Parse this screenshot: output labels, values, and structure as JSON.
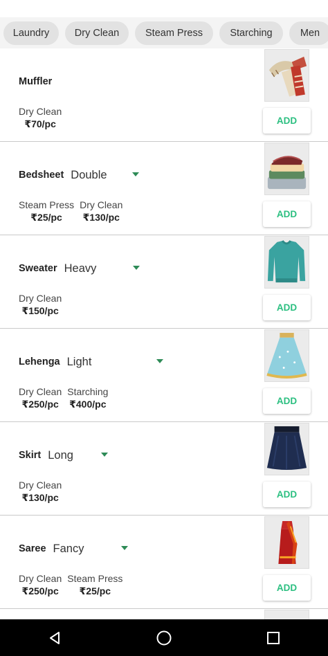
{
  "tabs": [
    "Laundry",
    "Dry Clean",
    "Steam Press",
    "Starching",
    "Men"
  ],
  "accent_color": "#2bbf80",
  "items": [
    {
      "name": "Muffler",
      "variant": "",
      "icon": "muffler-icon",
      "services": [
        {
          "name": "Dry Clean",
          "price": "₹70/pc"
        }
      ],
      "add_label": "ADD"
    },
    {
      "name": "Bedsheet",
      "variant": "Double",
      "icon": "bedsheet-icon",
      "services": [
        {
          "name": "Steam Press",
          "price": "₹25/pc"
        },
        {
          "name": "Dry Clean",
          "price": "₹130/pc"
        }
      ],
      "add_label": "ADD"
    },
    {
      "name": "Sweater",
      "variant": "Heavy",
      "icon": "sweater-icon",
      "services": [
        {
          "name": "Dry Clean",
          "price": "₹150/pc"
        }
      ],
      "add_label": "ADD"
    },
    {
      "name": "Lehenga",
      "variant": "Light",
      "icon": "lehenga-icon",
      "services": [
        {
          "name": "Dry Clean",
          "price": "₹250/pc"
        },
        {
          "name": "Starching",
          "price": "₹400/pc"
        }
      ],
      "add_label": "ADD"
    },
    {
      "name": "Skirt",
      "variant": "Long",
      "icon": "skirt-icon",
      "services": [
        {
          "name": "Dry Clean",
          "price": "₹130/pc"
        }
      ],
      "add_label": "ADD"
    },
    {
      "name": "Saree",
      "variant": "Fancy",
      "icon": "saree-icon",
      "services": [
        {
          "name": "Dry Clean",
          "price": "₹250/pc"
        },
        {
          "name": "Steam Press",
          "price": "₹25/pc"
        }
      ],
      "add_label": "ADD"
    }
  ],
  "navbar": {
    "back": "back-icon",
    "home": "home-icon",
    "recents": "recents-icon"
  }
}
